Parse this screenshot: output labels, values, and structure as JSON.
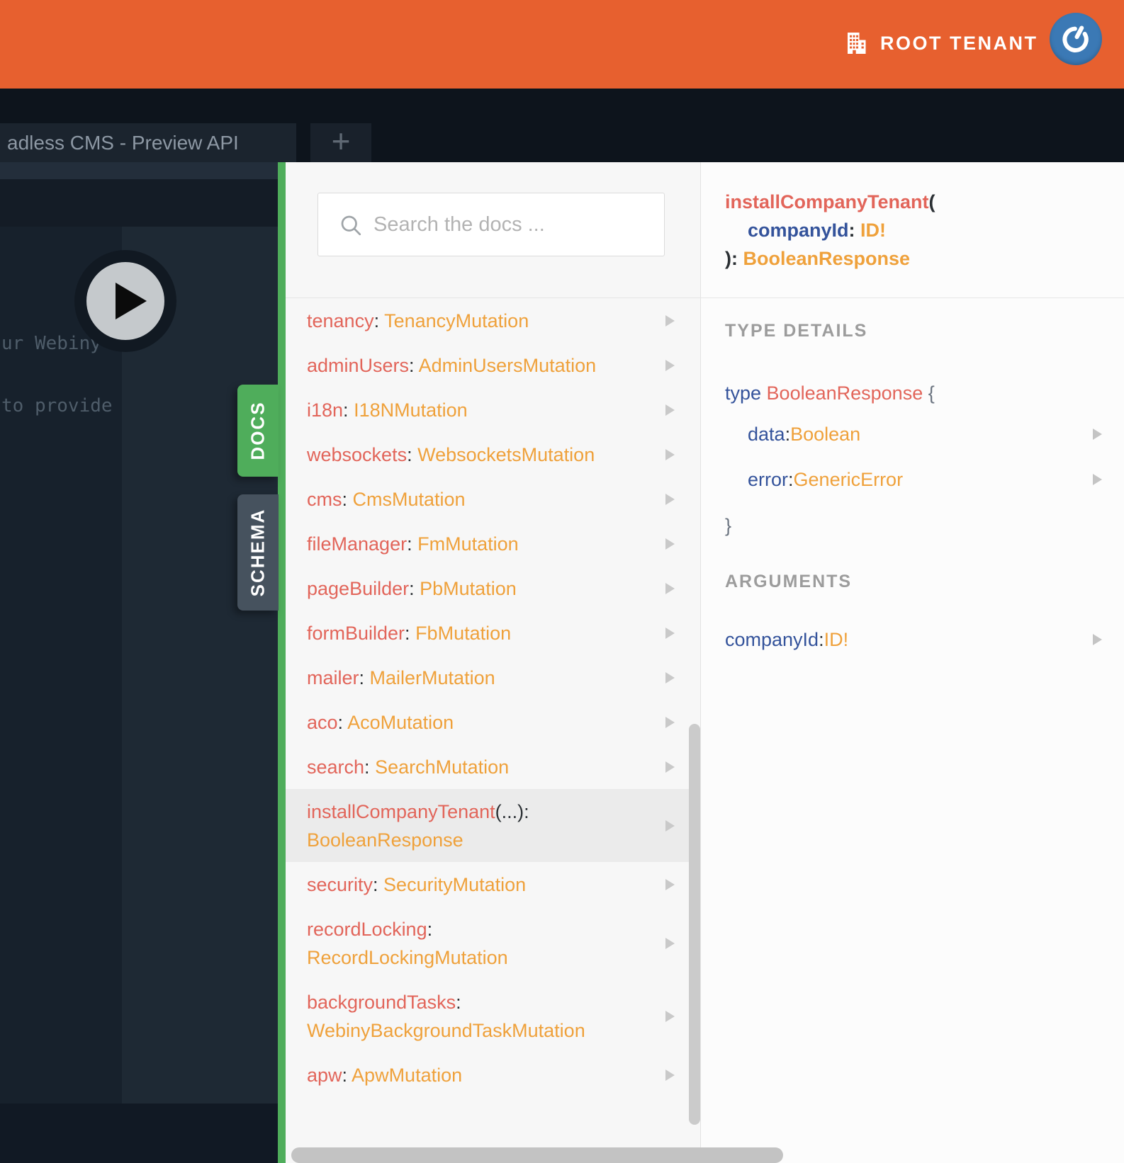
{
  "topbar": {
    "tenant_label": "ROOT TENANT"
  },
  "tabbar": {
    "active_tab_title": "adless CMS - Preview API",
    "new_tab_label": "+"
  },
  "editor": {
    "comment_line_1": "ur Webiny",
    "comment_line_2": "to provide"
  },
  "docs": {
    "search_placeholder": "Search the docs ...",
    "side_tabs": {
      "docs": "DOCS",
      "schema": "SCHEMA"
    },
    "list": [
      {
        "hl": false,
        "tall": false,
        "lines": [
          [
            {
              "t": "tenancy",
              "c": "field"
            },
            {
              "t": ": ",
              "c": "punct"
            },
            {
              "t": "TenancyMutation",
              "c": "type"
            }
          ]
        ]
      },
      {
        "hl": false,
        "tall": false,
        "lines": [
          [
            {
              "t": "adminUsers",
              "c": "field"
            },
            {
              "t": ": ",
              "c": "punct"
            },
            {
              "t": "AdminUsersMutation",
              "c": "type"
            }
          ]
        ]
      },
      {
        "hl": false,
        "tall": false,
        "lines": [
          [
            {
              "t": "i18n",
              "c": "field"
            },
            {
              "t": ": ",
              "c": "punct"
            },
            {
              "t": "I18NMutation",
              "c": "type"
            }
          ]
        ]
      },
      {
        "hl": false,
        "tall": false,
        "lines": [
          [
            {
              "t": "websockets",
              "c": "field"
            },
            {
              "t": ": ",
              "c": "punct"
            },
            {
              "t": "WebsocketsMutation",
              "c": "type"
            }
          ]
        ]
      },
      {
        "hl": false,
        "tall": false,
        "lines": [
          [
            {
              "t": "cms",
              "c": "field"
            },
            {
              "t": ": ",
              "c": "punct"
            },
            {
              "t": "CmsMutation",
              "c": "type"
            }
          ]
        ]
      },
      {
        "hl": false,
        "tall": false,
        "lines": [
          [
            {
              "t": "fileManager",
              "c": "field"
            },
            {
              "t": ": ",
              "c": "punct"
            },
            {
              "t": "FmMutation",
              "c": "type"
            }
          ]
        ]
      },
      {
        "hl": false,
        "tall": false,
        "lines": [
          [
            {
              "t": "pageBuilder",
              "c": "field"
            },
            {
              "t": ": ",
              "c": "punct"
            },
            {
              "t": "PbMutation",
              "c": "type"
            }
          ]
        ]
      },
      {
        "hl": false,
        "tall": false,
        "lines": [
          [
            {
              "t": "formBuilder",
              "c": "field"
            },
            {
              "t": ": ",
              "c": "punct"
            },
            {
              "t": "FbMutation",
              "c": "type"
            }
          ]
        ]
      },
      {
        "hl": false,
        "tall": false,
        "lines": [
          [
            {
              "t": "mailer",
              "c": "field"
            },
            {
              "t": ": ",
              "c": "punct"
            },
            {
              "t": "MailerMutation",
              "c": "type"
            }
          ]
        ]
      },
      {
        "hl": false,
        "tall": false,
        "lines": [
          [
            {
              "t": "aco",
              "c": "field"
            },
            {
              "t": ": ",
              "c": "punct"
            },
            {
              "t": "AcoMutation",
              "c": "type"
            }
          ]
        ]
      },
      {
        "hl": false,
        "tall": false,
        "lines": [
          [
            {
              "t": "search",
              "c": "field"
            },
            {
              "t": ": ",
              "c": "punct"
            },
            {
              "t": "SearchMutation",
              "c": "type"
            }
          ]
        ]
      },
      {
        "hl": true,
        "tall": true,
        "lines": [
          [
            {
              "t": "installCompanyTenant",
              "c": "field"
            },
            {
              "t": "(...):",
              "c": "punct"
            }
          ],
          [
            {
              "t": "BooleanResponse",
              "c": "type"
            }
          ]
        ]
      },
      {
        "hl": false,
        "tall": false,
        "lines": [
          [
            {
              "t": "security",
              "c": "field"
            },
            {
              "t": ": ",
              "c": "punct"
            },
            {
              "t": "SecurityMutation",
              "c": "type"
            }
          ]
        ]
      },
      {
        "hl": false,
        "tall": true,
        "lines": [
          [
            {
              "t": "recordLocking",
              "c": "field"
            },
            {
              "t": ":",
              "c": "punct"
            }
          ],
          [
            {
              "t": "RecordLockingMutation",
              "c": "type"
            }
          ]
        ]
      },
      {
        "hl": false,
        "tall": true,
        "lines": [
          [
            {
              "t": "backgroundTasks",
              "c": "field"
            },
            {
              "t": ":",
              "c": "punct"
            }
          ],
          [
            {
              "t": "WebinyBackgroundTaskMutation",
              "c": "type"
            }
          ]
        ]
      },
      {
        "hl": false,
        "tall": false,
        "lines": [
          [
            {
              "t": "apw",
              "c": "field"
            },
            {
              "t": ": ",
              "c": "punct"
            },
            {
              "t": "ApwMutation",
              "c": "type"
            }
          ]
        ]
      }
    ]
  },
  "detail": {
    "signature": {
      "lines": [
        {
          "indent": 0,
          "segs": [
            {
              "t": "installCompanyTenant",
              "c": "field-b"
            },
            {
              "t": "(",
              "c": "punct-b"
            }
          ]
        },
        {
          "indent": 1,
          "segs": [
            {
              "t": "companyId",
              "c": "arg-b"
            },
            {
              "t": ": ",
              "c": "punct-b"
            },
            {
              "t": "ID!",
              "c": "type-b"
            }
          ]
        },
        {
          "indent": 0,
          "segs": [
            {
              "t": "): ",
              "c": "punct-b"
            },
            {
              "t": "BooleanResponse",
              "c": "type-b"
            }
          ]
        }
      ]
    },
    "type_details_label": "TYPE DETAILS",
    "type_declaration": [
      {
        "t": "type ",
        "c": "kw"
      },
      {
        "t": "BooleanResponse",
        "c": "field"
      },
      {
        "t": " {",
        "c": "brace"
      }
    ],
    "type_fields": [
      {
        "segs": [
          {
            "t": "data",
            "c": "arg"
          },
          {
            "t": ": ",
            "c": "punct"
          },
          {
            "t": "Boolean",
            "c": "type"
          }
        ]
      },
      {
        "segs": [
          {
            "t": "error",
            "c": "arg"
          },
          {
            "t": ": ",
            "c": "punct"
          },
          {
            "t": "GenericError",
            "c": "type"
          }
        ]
      }
    ],
    "closing_brace": "}",
    "arguments_label": "ARGUMENTS",
    "argument_rows": [
      {
        "segs": [
          {
            "t": "companyId",
            "c": "arg"
          },
          {
            "t": ": ",
            "c": "punct"
          },
          {
            "t": "ID!",
            "c": "type"
          }
        ]
      }
    ]
  },
  "colors": {
    "topbar_orange": "#E7602F",
    "docs_green": "#4FAD5B",
    "schema_slate": "#46525E",
    "field_red": "#E2655A",
    "type_orange": "#EFA13B",
    "keyword_blue": "#34539B",
    "avatar_blue": "#3B79B5"
  }
}
